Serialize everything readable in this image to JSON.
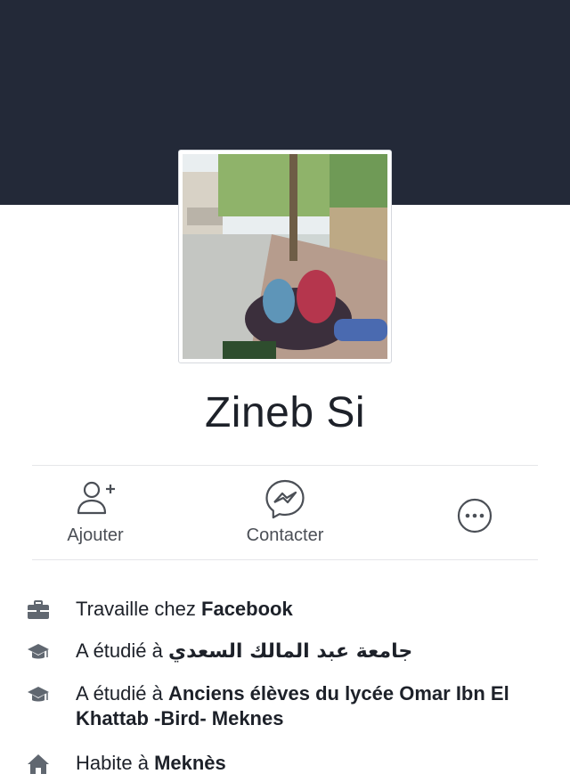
{
  "profile": {
    "name": "Zineb Si"
  },
  "actions": [
    {
      "label": "Ajouter",
      "icon": "add-friend-icon"
    },
    {
      "label": "Contacter",
      "icon": "messenger-icon"
    },
    {
      "label": "",
      "icon": "more-icon"
    }
  ],
  "info": [
    {
      "icon": "briefcase-icon",
      "prefix": "Travaille chez ",
      "value": "Facebook"
    },
    {
      "icon": "graduation-cap-icon",
      "prefix": "A étudié à ",
      "value": "جامعة عبد المالك السعدي"
    },
    {
      "icon": "graduation-cap-icon",
      "prefix": "A étudié à ",
      "value": "Anciens élèves du lycée Omar Ibn El Khattab -Bird- Meknes"
    },
    {
      "icon": "home-icon",
      "prefix": "Habite à ",
      "value": "Meknès"
    }
  ],
  "colors": {
    "cover": "#232938",
    "icon_gray": "#4b4f56",
    "text": "#1d2129",
    "divider": "#e5e6e9"
  }
}
